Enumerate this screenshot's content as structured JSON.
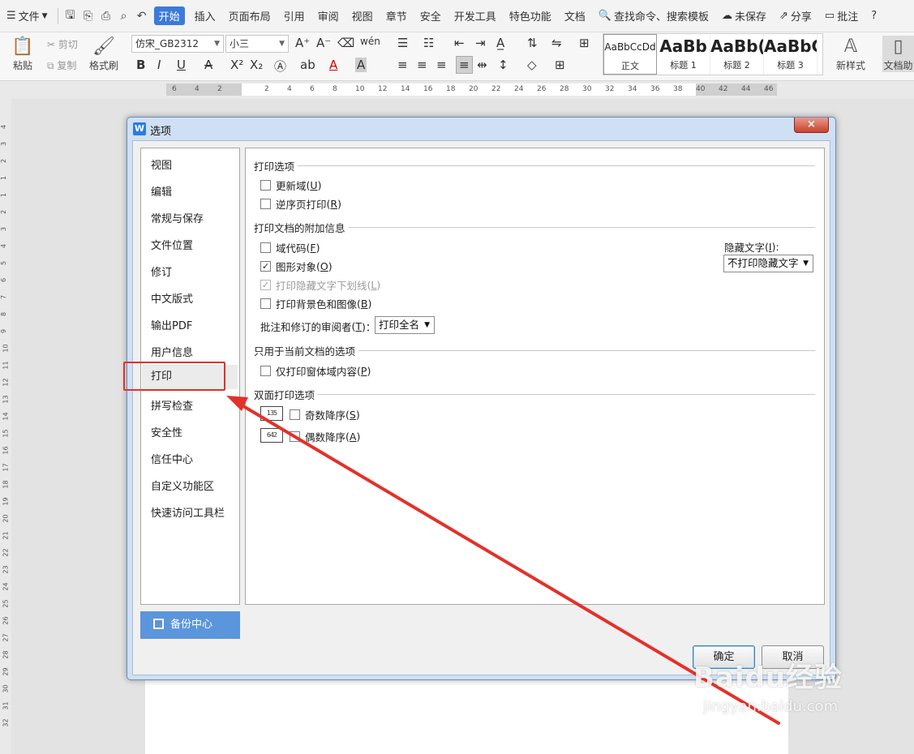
{
  "menubar": {
    "file_label": "文件",
    "tabs": [
      "开始",
      "插入",
      "页面布局",
      "引用",
      "审阅",
      "视图",
      "章节",
      "安全",
      "开发工具",
      "特色功能",
      "文档"
    ],
    "active_tab": "开始",
    "search_label": "查找命令、搜索模板",
    "unsaved_label": "未保存",
    "share_label": "分享",
    "comment_label": "批注",
    "help_label": "?"
  },
  "ribbon": {
    "paste_label": "粘贴",
    "cut_label": "剪切",
    "copy_label": "复制",
    "format_painter_label": "格式刷",
    "font_name": "仿宋_GB2312",
    "font_size": "小三",
    "styles": [
      {
        "sample": "AaBbCcDd",
        "name": "正文"
      },
      {
        "sample": "AaBb",
        "name": "标题 1"
      },
      {
        "sample": "AaBb(",
        "name": "标题 2"
      },
      {
        "sample": "AaBbC",
        "name": "标题 3"
      }
    ],
    "new_style_label": "新样式",
    "doc_helper_label": "文档助"
  },
  "ruler": {
    "h_ticks": [
      "6",
      "4",
      "2",
      "2",
      "4",
      "6",
      "8",
      "10",
      "12",
      "14",
      "16",
      "18",
      "20",
      "22",
      "24",
      "26",
      "28",
      "30",
      "32",
      "34",
      "36",
      "38",
      "40",
      "42",
      "44",
      "46"
    ],
    "v_ticks": [
      "4",
      "3",
      "2",
      "1",
      "1",
      "2",
      "3",
      "4",
      "5",
      "6",
      "7",
      "8",
      "9",
      "10",
      "11",
      "12",
      "13",
      "14",
      "15",
      "16",
      "17",
      "18",
      "19",
      "20",
      "21",
      "22",
      "23",
      "24",
      "25",
      "26",
      "27",
      "28",
      "29",
      "30",
      "31",
      "32"
    ]
  },
  "dialog": {
    "title": "选项",
    "close_icon": "×",
    "nav_items": [
      "视图",
      "编辑",
      "常规与保存",
      "文件位置",
      "修订",
      "中文版式",
      "输出PDF",
      "用户信息",
      "打印",
      "拼写检查",
      "安全性",
      "信任中心",
      "自定义功能区",
      "快速访问工具栏"
    ],
    "selected_nav": "打印",
    "backup_label": "备份中心",
    "sections": {
      "print_options": "打印选项",
      "extra_info": "打印文档的附加信息",
      "current_doc": "只用于当前文档的选项",
      "duplex": "双面打印选项"
    },
    "options": {
      "update_fields": {
        "label": "更新域",
        "key": "U",
        "checked": false
      },
      "reverse_order": {
        "label": "逆序页打印",
        "key": "R",
        "checked": false
      },
      "field_codes": {
        "label": "域代码",
        "key": "F",
        "checked": false
      },
      "drawing_objects": {
        "label": "图形对象",
        "key": "O",
        "checked": true
      },
      "hidden_underline": {
        "label": "打印隐藏文字下划线",
        "key": "L",
        "checked": true,
        "disabled": true
      },
      "background": {
        "label": "打印背景色和图像",
        "key": "B",
        "checked": false
      },
      "form_data_only": {
        "label": "仅打印窗体域内容",
        "key": "P",
        "checked": false
      },
      "odd_desc": {
        "label": "奇数降序",
        "key": "S",
        "checked": false
      },
      "even_desc": {
        "label": "偶数降序",
        "key": "A",
        "checked": false
      }
    },
    "hidden_text_label": "隐藏文字",
    "hidden_text_key": "I",
    "hidden_text_value": "不打印隐藏文字",
    "reviewer_label": "批注和修订的审阅者",
    "reviewer_key": "T",
    "reviewer_value": "打印全名",
    "duplex_odd_icon": "135",
    "duplex_even_icon": "642",
    "ok_label": "确定",
    "cancel_label": "取消"
  },
  "watermark": {
    "brand": "Baidu经验",
    "url": "jingyan.baidu.com"
  },
  "colors": {
    "accent": "#3c7ad9",
    "annotation_red": "#e3312a",
    "backup_blue": "#5b95db"
  }
}
